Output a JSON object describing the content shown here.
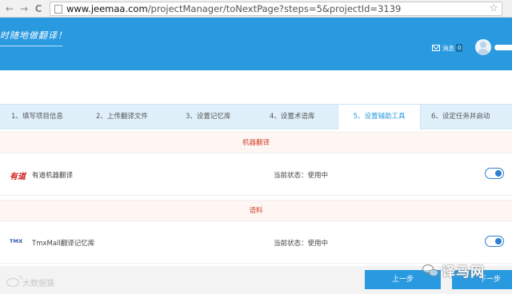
{
  "browser": {
    "back_icon": "←",
    "forward_icon": "→",
    "reload_icon": "C",
    "url_host": "www.jeemaa.com",
    "url_path": "/projectManager/toNextPage?steps=5&projectId=3139",
    "star_icon": "☆"
  },
  "header": {
    "slogan": "时随地做翻译！",
    "messages_label": "消息",
    "messages_count": "0",
    "accent_color": "#2a9ae0"
  },
  "tabs": [
    {
      "label": "1、填写项目信息"
    },
    {
      "label": "2、上传翻译文件"
    },
    {
      "label": "3、设置记忆库"
    },
    {
      "label": "4、设置术语库"
    },
    {
      "label": "5、设置辅助工具"
    },
    {
      "label": "6、设定任务并启动"
    }
  ],
  "active_tab": 4,
  "sections": [
    {
      "title": "机器翻译",
      "tools": [
        {
          "logo": "有道",
          "name": "有道机器翻译",
          "status": "当前状态：使用中",
          "enabled": true
        }
      ]
    },
    {
      "title": "语料",
      "tools": [
        {
          "logo": "TMX",
          "name": "TmxMall翻译记忆库",
          "status": "当前状态：使用中",
          "enabled": true
        }
      ]
    }
  ],
  "footer": {
    "prev_label": "上一步",
    "next_label": "下一步",
    "watermark_left": "大数据猿",
    "watermark_right": "译马网"
  }
}
